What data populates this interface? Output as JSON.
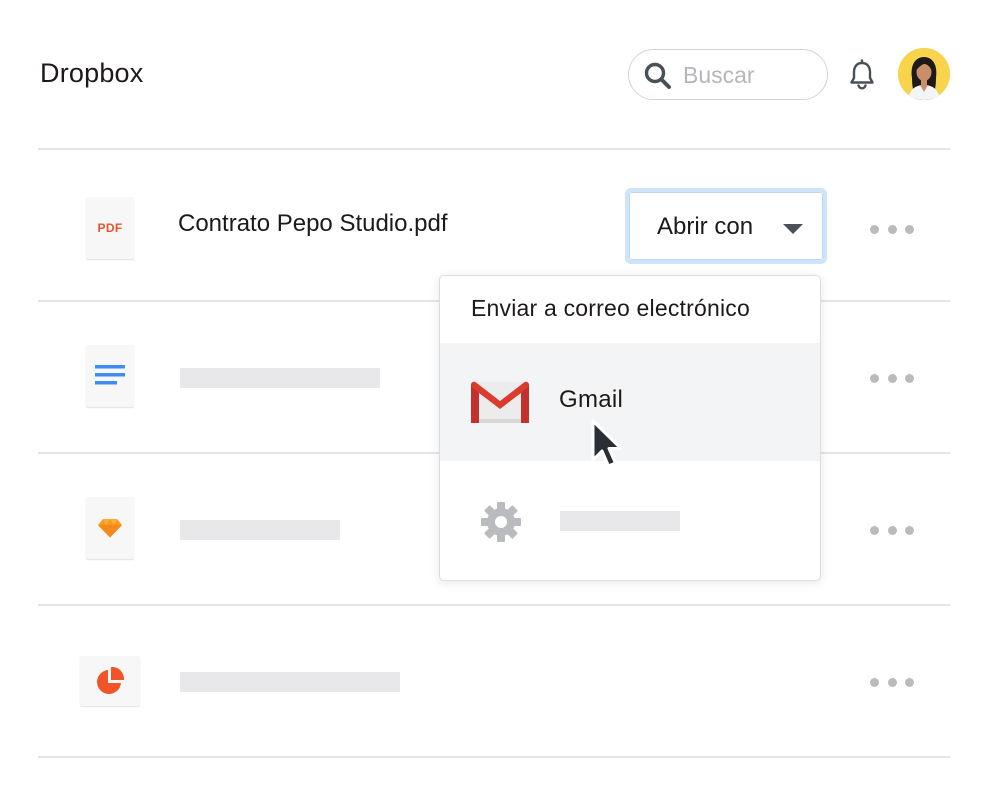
{
  "header": {
    "app_title": "Dropbox",
    "search": {
      "placeholder": "Buscar",
      "value": ""
    },
    "notifications_icon": "bell-icon",
    "avatar_icon": "user-avatar"
  },
  "files": [
    {
      "icon": "pdf-file-icon",
      "icon_label": "PDF",
      "name": "Contrato Pepo Studio.pdf"
    },
    {
      "icon": "document-file-icon",
      "name": ""
    },
    {
      "icon": "sketch-file-icon",
      "name": ""
    },
    {
      "icon": "chart-file-icon",
      "name": ""
    }
  ],
  "open_with": {
    "label": "Abrir con",
    "caret_icon": "caret-down-icon"
  },
  "menu": {
    "header": "Enviar a correo electrónico",
    "items": [
      {
        "icon": "gmail-icon",
        "label": "Gmail",
        "highlighted": true
      },
      {
        "icon": "gear-icon",
        "label": ""
      }
    ]
  },
  "more_icon": "more-horizontal-icon",
  "colors": {
    "divider": "#e4e5e7",
    "placeholder": "#e8e8ea",
    "accent_focus": "#cfe4f8",
    "pdf_red": "#e8552b",
    "doc_blue": "#3d8ef0",
    "sketch_orange": "#f79b1c",
    "chart_red": "#f0552a",
    "gmail_red": "#d93b2f",
    "avatar_bg": "#f7d44c"
  }
}
